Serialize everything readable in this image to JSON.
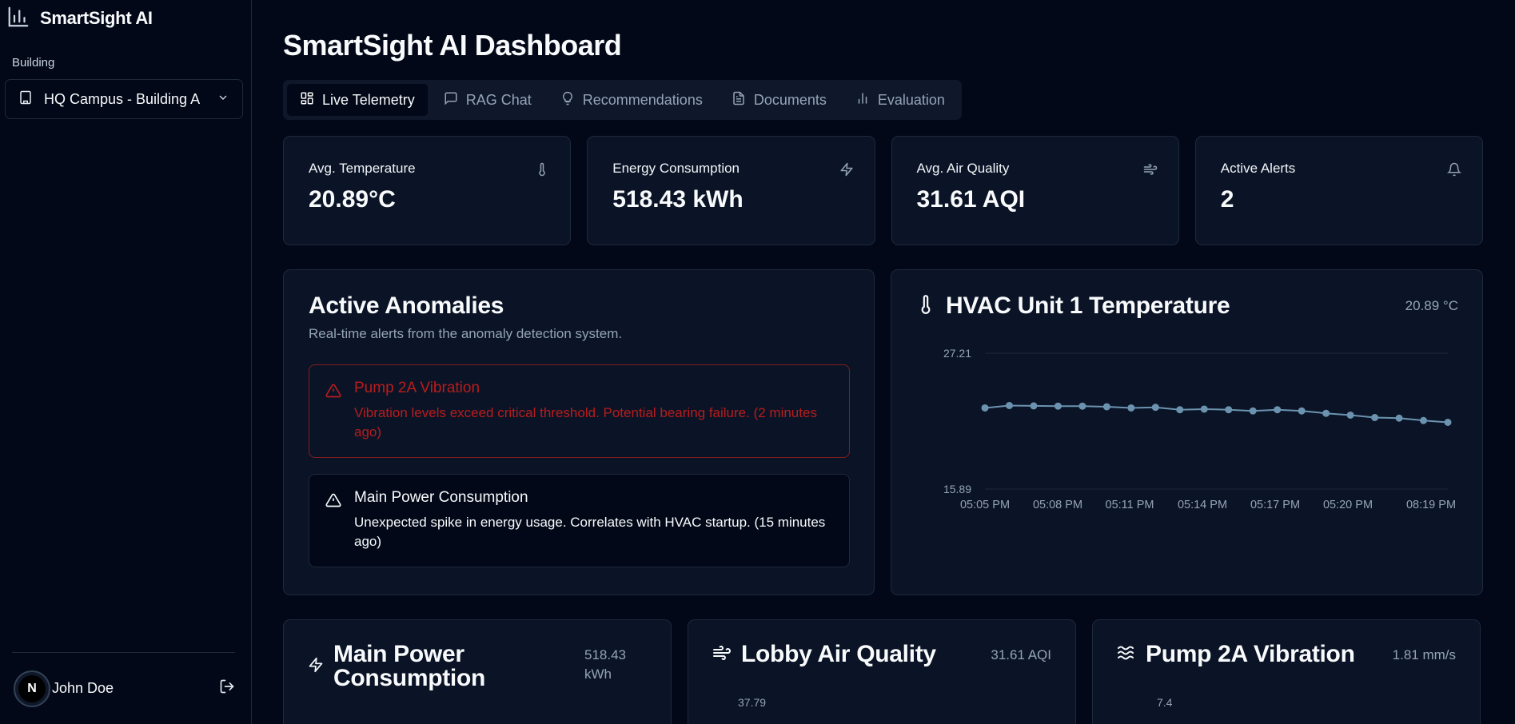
{
  "brand": {
    "name": "SmartSight AI"
  },
  "sidebar": {
    "building_label": "Building",
    "building_value": "HQ Campus - Building A",
    "user_name": "John Doe",
    "avatar_letter": "N"
  },
  "page": {
    "title": "SmartSight AI Dashboard"
  },
  "tabs": [
    {
      "label": "Live Telemetry",
      "active": true
    },
    {
      "label": "RAG Chat"
    },
    {
      "label": "Recommendations"
    },
    {
      "label": "Documents"
    },
    {
      "label": "Evaluation"
    }
  ],
  "stats": [
    {
      "label": "Avg. Temperature",
      "value": "20.89°C",
      "icon": "thermometer-icon"
    },
    {
      "label": "Energy Consumption",
      "value": "518.43 kWh",
      "icon": "zap-icon"
    },
    {
      "label": "Avg. Air Quality",
      "value": "31.61 AQI",
      "icon": "wind-icon"
    },
    {
      "label": "Active Alerts",
      "value": "2",
      "icon": "bell-icon"
    }
  ],
  "anomalies": {
    "title": "Active Anomalies",
    "subtitle": "Real-time alerts from the anomaly detection system.",
    "items": [
      {
        "title": "Pump 2A Vibration",
        "description": "Vibration levels exceed critical threshold. Potential bearing failure. (2 minutes ago)",
        "severity": "critical",
        "color": "#b91c1c"
      },
      {
        "title": "Main Power Consumption",
        "description": "Unexpected spike in energy usage. Correlates with HVAC startup. (15 minutes ago)",
        "severity": "warning"
      }
    ]
  },
  "hvac": {
    "title": "HVAC Unit 1 Temperature",
    "readout": "20.89 °C",
    "line_color": "#6b93b0"
  },
  "chart_data": {
    "type": "line",
    "ylim": [
      15.89,
      27.21
    ],
    "yticks": [
      "27.21",
      "15.89"
    ],
    "xtick_labels": [
      "05:05 PM",
      "05:08 PM",
      "05:11 PM",
      "05:14 PM",
      "05:17 PM",
      "05:20 PM",
      "08:19 PM"
    ],
    "series": [
      {
        "values": [
          22.65,
          22.85,
          22.82,
          22.8,
          22.8,
          22.75,
          22.65,
          22.7,
          22.5,
          22.55,
          22.5,
          22.4,
          22.5,
          22.4,
          22.2,
          22.05,
          21.85,
          21.8,
          21.6,
          21.45
        ]
      }
    ]
  },
  "mini_cards": [
    {
      "title": "Main Power Consumption",
      "title_line1": "Main Power",
      "title_line2": "Consumption",
      "readout_line1": "518.43",
      "readout_line2": "kWh",
      "icon": "zap-icon",
      "ytick": ""
    },
    {
      "title": "Lobby Air Quality",
      "readout": "31.61 AQI",
      "icon": "wind-icon",
      "ytick": "37.79"
    },
    {
      "title": "Pump 2A Vibration",
      "readout": "1.81 mm/s",
      "icon": "waves-icon",
      "ytick": "7.4"
    }
  ]
}
